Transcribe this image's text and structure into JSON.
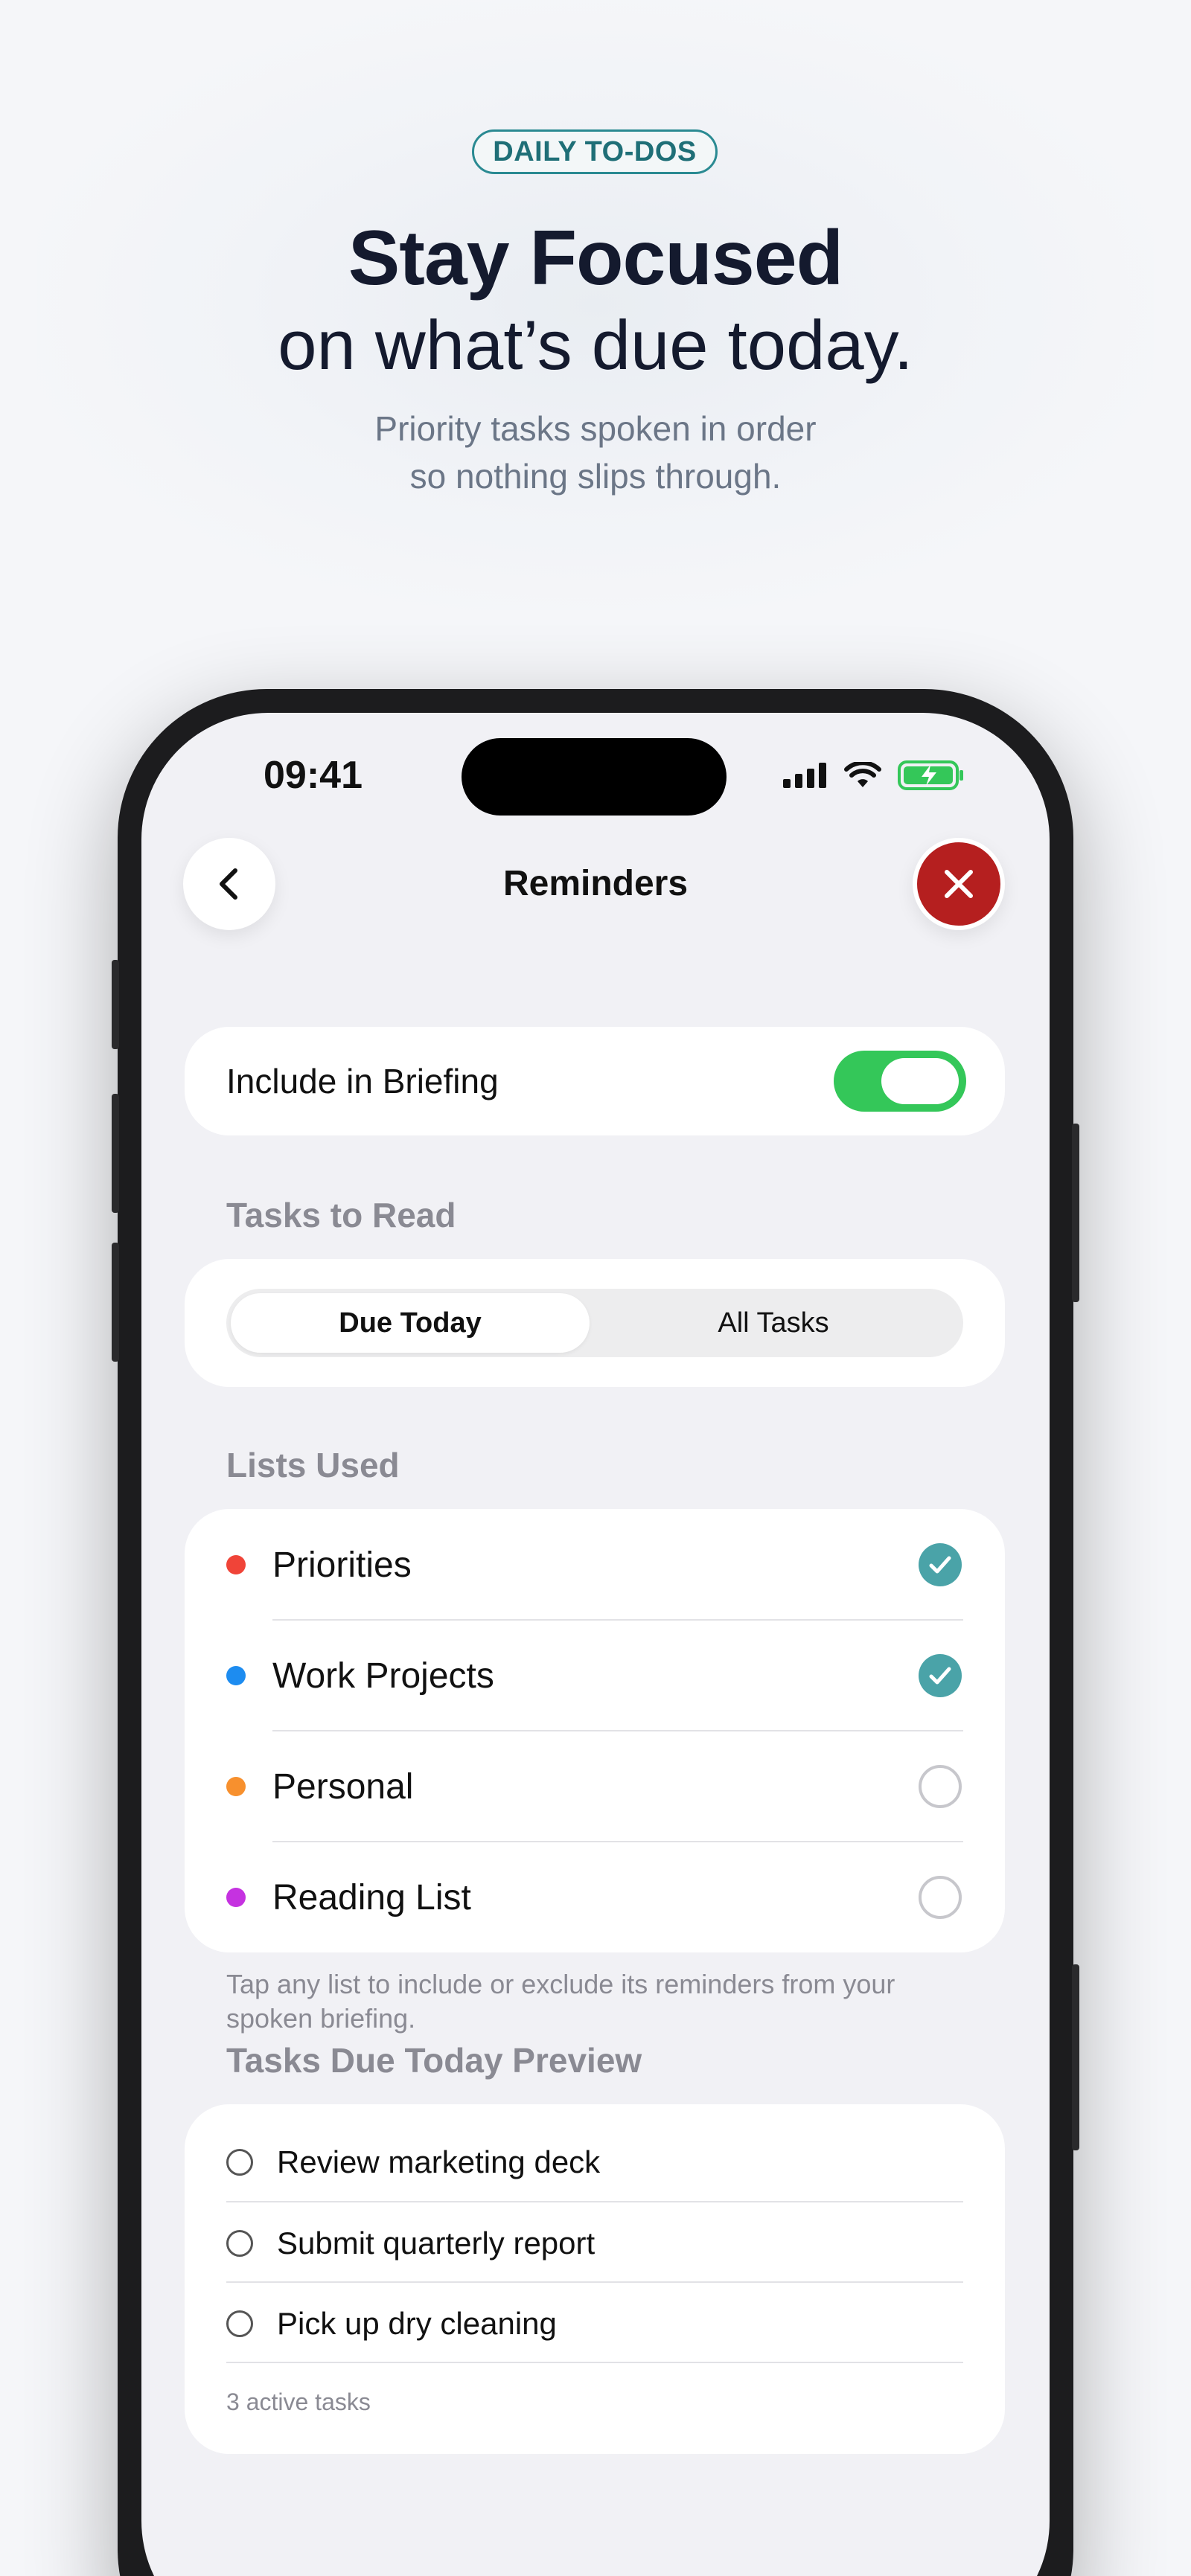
{
  "hero": {
    "badge": "DAILY TO-DOS",
    "headline": "Stay Focused",
    "headline2": "on what’s due today.",
    "subtitle_line1": "Priority tasks spoken in order",
    "subtitle_line2": "so nothing slips through."
  },
  "status_bar": {
    "time": "09:41"
  },
  "nav": {
    "title": "Reminders",
    "back_icon": "chevron-left-icon",
    "close_icon": "close-icon"
  },
  "briefing": {
    "label": "Include in Briefing",
    "enabled": true
  },
  "tasks_to_read": {
    "label": "Tasks to Read",
    "options": [
      "Due Today",
      "All Tasks"
    ],
    "selected": "Due Today"
  },
  "lists_used": {
    "label": "Lists Used",
    "items": [
      {
        "name": "Priorities",
        "color": "#f04438",
        "checked": true
      },
      {
        "name": "Work Projects",
        "color": "#1d8cf0",
        "checked": true
      },
      {
        "name": "Personal",
        "color": "#f7902e",
        "checked": false
      },
      {
        "name": "Reading List",
        "color": "#c532e0",
        "checked": false
      }
    ],
    "hint": "Tap any list to include or exclude its reminders from your spoken briefing."
  },
  "preview": {
    "label": "Tasks Due Today Preview",
    "tasks": [
      "Review marketing deck",
      "Submit quarterly report",
      "Pick up dry cleaning"
    ],
    "count": "3 active tasks"
  },
  "colors": {
    "accent": "#2a8a92",
    "toggle_on": "#34c759",
    "check": "#4aa3a8",
    "close": "#b51f1f"
  }
}
